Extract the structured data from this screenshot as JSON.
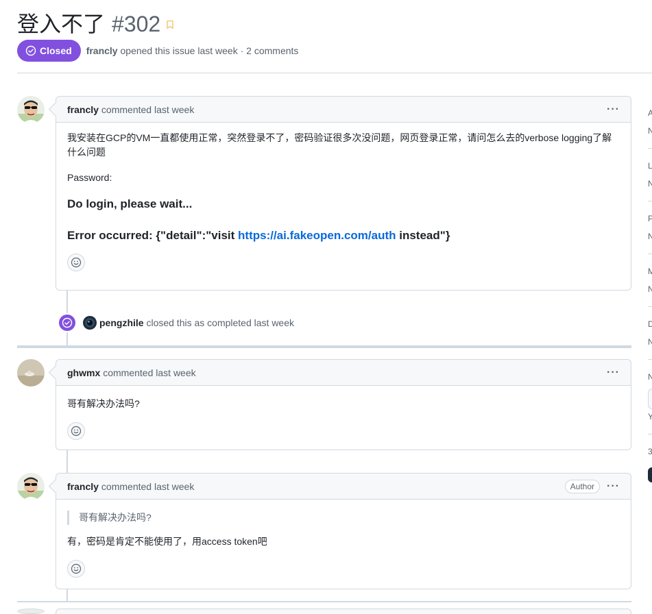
{
  "issue": {
    "title": "登入不了",
    "number": "#302",
    "state": "Closed",
    "author": "francly",
    "meta_suffix": "opened this issue last week · 2 comments"
  },
  "colors": {
    "closed_purple": "#8250df",
    "link_blue": "#0969da",
    "border": "#d1d9e0"
  },
  "comments": [
    {
      "author": "francly",
      "action": "commented last week",
      "body_line1": "我安装在GCP的VM一直都使用正常，突然登录不了，密码验证很多次没问题，网页登录正常，请问怎么去的verbose logging了解什么问题",
      "body_password": "Password:",
      "body_heading1": "Do login, please wait...",
      "body_heading2_prefix": "Error occurred: {\"detail\":\"visit ",
      "body_heading2_link": "https://ai.fakeopen.com/auth",
      "body_heading2_suffix": " instead\"}"
    },
    {
      "author": "ghwmx",
      "action": "commented last week",
      "body": "哥有解决办法吗?"
    },
    {
      "author": "francly",
      "action": "commented last week",
      "badge": "Author",
      "quote": "哥有解决办法吗?",
      "body": "有，密码是肯定不能使用了，用access token吧"
    }
  ],
  "event": {
    "actor": "pengzhile",
    "text": "closed this as completed last week",
    "icon": "check-circle-icon"
  },
  "menu_glyph": "···",
  "sidebar_letters": [
    "A",
    "N",
    "L",
    "N",
    "P",
    "N",
    "M",
    "N",
    "D",
    "N",
    "N",
    "Y",
    "3"
  ]
}
